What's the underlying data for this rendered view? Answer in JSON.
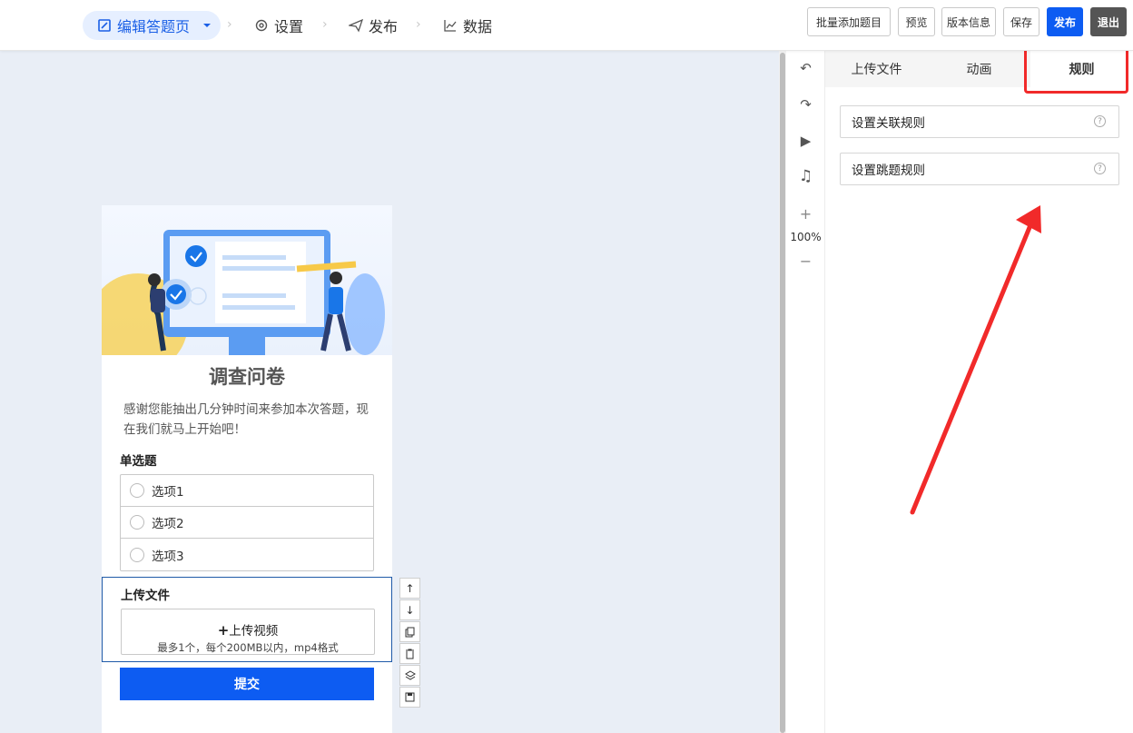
{
  "topbar": {
    "steps": [
      {
        "label": "编辑答题页",
        "icon": "edit-icon"
      },
      {
        "label": "设置",
        "icon": "gear-icon"
      },
      {
        "label": "发布",
        "icon": "send-icon"
      },
      {
        "label": "数据",
        "icon": "chart-icon"
      }
    ],
    "buttons": {
      "batch_add": "批量添加题目",
      "preview": "预览",
      "version": "版本信息",
      "save": "保存",
      "publish": "发布",
      "exit": "退出"
    },
    "colors": {
      "accent": "#0d5cf2",
      "exit": "#555555"
    }
  },
  "survey": {
    "title": "调查问卷",
    "description": "感谢您能抽出几分钟时间来参加本次答题，现在我们就马上开始吧！",
    "single_choice": {
      "title": "单选题",
      "options": [
        "选项1",
        "选项2",
        "选项3"
      ]
    },
    "upload": {
      "title": "上传文件",
      "button": "上传视频",
      "hint": "最多1个，每个200MB以内，mp4格式"
    },
    "submit": "提交"
  },
  "side_tools": {
    "zoom": "100%",
    "icons": [
      "undo-icon",
      "redo-icon",
      "play-icon",
      "music-icon",
      "zoom-in-icon",
      "zoom-out-icon"
    ]
  },
  "panel": {
    "tabs": [
      "上传文件",
      "动画",
      "规则"
    ],
    "active_tab": "规则",
    "rules": [
      "设置关联规则",
      "设置跳题规则"
    ]
  },
  "annotation": {
    "highlight_color": "#f12a2a"
  }
}
